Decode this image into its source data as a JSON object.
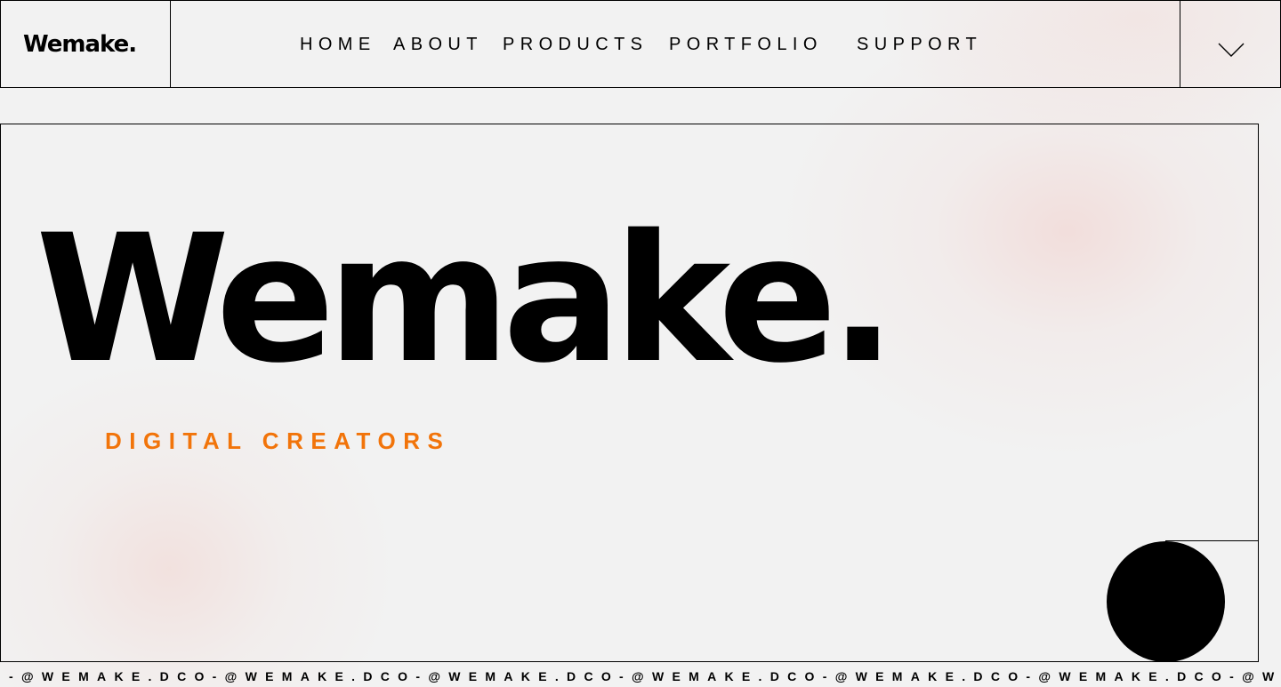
{
  "brand": {
    "logo": "Wemake."
  },
  "nav": {
    "items": [
      {
        "label": "HOME"
      },
      {
        "label": "ABOUT"
      },
      {
        "label": "PRODUCTS"
      },
      {
        "label": "PORTFOLIO"
      },
      {
        "label": "SUPPORT"
      }
    ],
    "menu_icon": "chevron-down-icon"
  },
  "hero": {
    "title": "Wemake.",
    "subtitle": "DIGITAL CREATORS",
    "accent_color": "#f2740a"
  },
  "decor": {
    "shape": "black-circle"
  },
  "marquee": {
    "text": "-@WEMAKE.DCO-@WEMAKE.DCO-@WEMAKE.DCO-@WEMAKE.DCO-@WEMAKE.DCO-@WEMAKE.DCO-@WEMA"
  }
}
